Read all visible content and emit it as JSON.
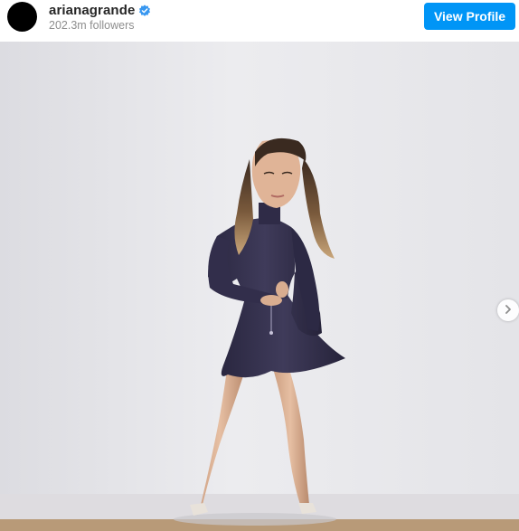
{
  "header": {
    "username": "arianagrande",
    "followers": "202.3m followers",
    "view_profile_label": "View Profile"
  },
  "post": {
    "photo": "woman in dark purple long-sleeve mini dress with high ponytail standing against a white wall"
  },
  "icons": {
    "verified": "verified-badge-icon",
    "next": "chevron-right-icon"
  },
  "colors": {
    "accent": "#0095f6",
    "verified": "#3897f0",
    "username": "#262626",
    "secondary_text": "#8e8e8e"
  }
}
